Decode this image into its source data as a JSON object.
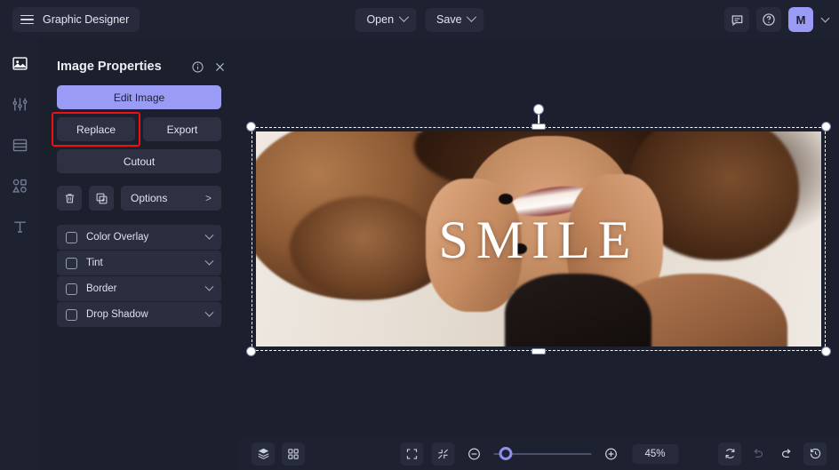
{
  "topbar": {
    "menu_icon": "hamburger-icon",
    "app_title": "Graphic Designer",
    "open_label": "Open",
    "save_label": "Save",
    "comment_icon": "comment-icon",
    "help_icon": "help-circle-icon",
    "avatar_initial": "M",
    "accent_color": "#9a9bf5"
  },
  "rail": {
    "items": [
      {
        "name": "image-tool",
        "icon": "image-icon",
        "active": true
      },
      {
        "name": "adjust-tool",
        "icon": "sliders-icon",
        "active": false
      },
      {
        "name": "template-tool",
        "icon": "layout-icon",
        "active": false
      },
      {
        "name": "elements-tool",
        "icon": "shapes-icon",
        "active": false
      },
      {
        "name": "text-tool",
        "icon": "text-icon",
        "active": false
      }
    ]
  },
  "panel": {
    "title": "Image Properties",
    "info_icon": "info-circle-icon",
    "close_icon": "close-icon",
    "edit_image_label": "Edit Image",
    "replace_label": "Replace",
    "export_label": "Export",
    "cutout_label": "Cutout",
    "delete_icon": "trash-icon",
    "duplicate_icon": "duplicate-icon",
    "options_label": "Options",
    "options_arrow": ">",
    "highlight_color": "#ef1111",
    "effects": [
      {
        "label": "Color Overlay",
        "checked": false
      },
      {
        "label": "Tint",
        "checked": false
      },
      {
        "label": "Border",
        "checked": false
      },
      {
        "label": "Drop Shadow",
        "checked": false
      }
    ]
  },
  "canvas": {
    "image_overlay_text": "SMILE",
    "selection_active": true,
    "background_color": "#1c1f2e"
  },
  "bottombar": {
    "layers_icon": "layers-icon",
    "grid_icon": "grid-icon",
    "fit_screen_icon": "fit-screen-icon",
    "shrink_icon": "shrink-icon",
    "zoom_out_icon": "zoom-out-icon",
    "zoom_in_icon": "zoom-in-icon",
    "zoom_value": "45%",
    "reset_icon": "reset-icon",
    "undo_icon": "undo-icon",
    "redo_icon": "redo-icon",
    "history_icon": "history-icon"
  }
}
